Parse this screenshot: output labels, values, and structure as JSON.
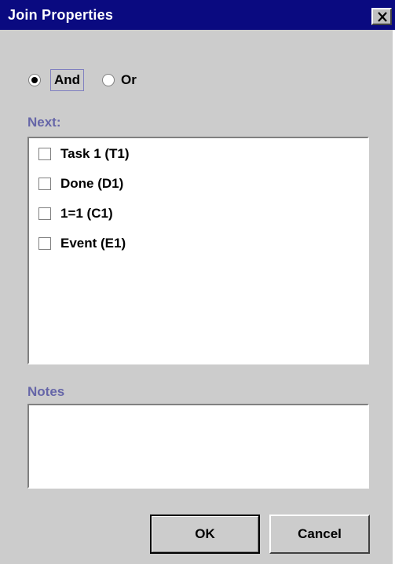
{
  "window": {
    "title": "Join Properties",
    "close_icon": "close-icon"
  },
  "join_type": {
    "options": [
      {
        "label": "And",
        "selected": true
      },
      {
        "label": "Or",
        "selected": false
      }
    ]
  },
  "next": {
    "label": "Next:",
    "items": [
      {
        "label": "Task 1 (T1)",
        "checked": false
      },
      {
        "label": "Done (D1)",
        "checked": false
      },
      {
        "label": "1=1 (C1)",
        "checked": false
      },
      {
        "label": "Event (E1)",
        "checked": false
      }
    ]
  },
  "notes": {
    "label": "Notes",
    "value": ""
  },
  "buttons": {
    "ok": "OK",
    "cancel": "Cancel"
  },
  "colors": {
    "titlebar": "#0a0a80",
    "section_label": "#6666a8",
    "background": "#cccccc"
  }
}
